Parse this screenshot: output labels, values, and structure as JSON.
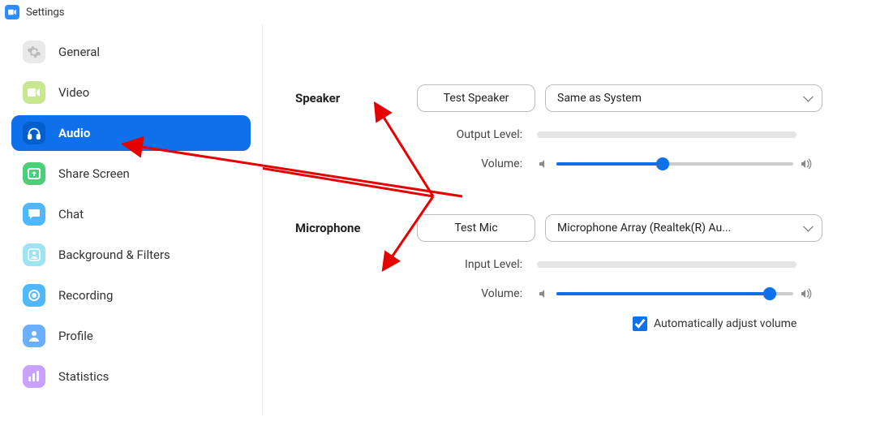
{
  "window_title": "Settings",
  "sidebar": {
    "items": [
      {
        "label": "General"
      },
      {
        "label": "Video"
      },
      {
        "label": "Audio"
      },
      {
        "label": "Share Screen"
      },
      {
        "label": "Chat"
      },
      {
        "label": "Background & Filters"
      },
      {
        "label": "Recording"
      },
      {
        "label": "Profile"
      },
      {
        "label": "Statistics"
      }
    ],
    "active_index": 2
  },
  "speaker": {
    "section_title": "Speaker",
    "test_label": "Test Speaker",
    "device_label": "Same as System",
    "output_level_label": "Output Level:",
    "volume_label": "Volume:",
    "volume_percent": 45
  },
  "microphone": {
    "section_title": "Microphone",
    "test_label": "Test Mic",
    "device_label": "Microphone Array (Realtek(R) Au...",
    "input_level_label": "Input Level:",
    "volume_label": "Volume:",
    "volume_percent": 90,
    "auto_adjust_label": "Automatically adjust volume",
    "auto_adjust_checked": true
  },
  "colors": {
    "accent": "#0e71eb"
  }
}
